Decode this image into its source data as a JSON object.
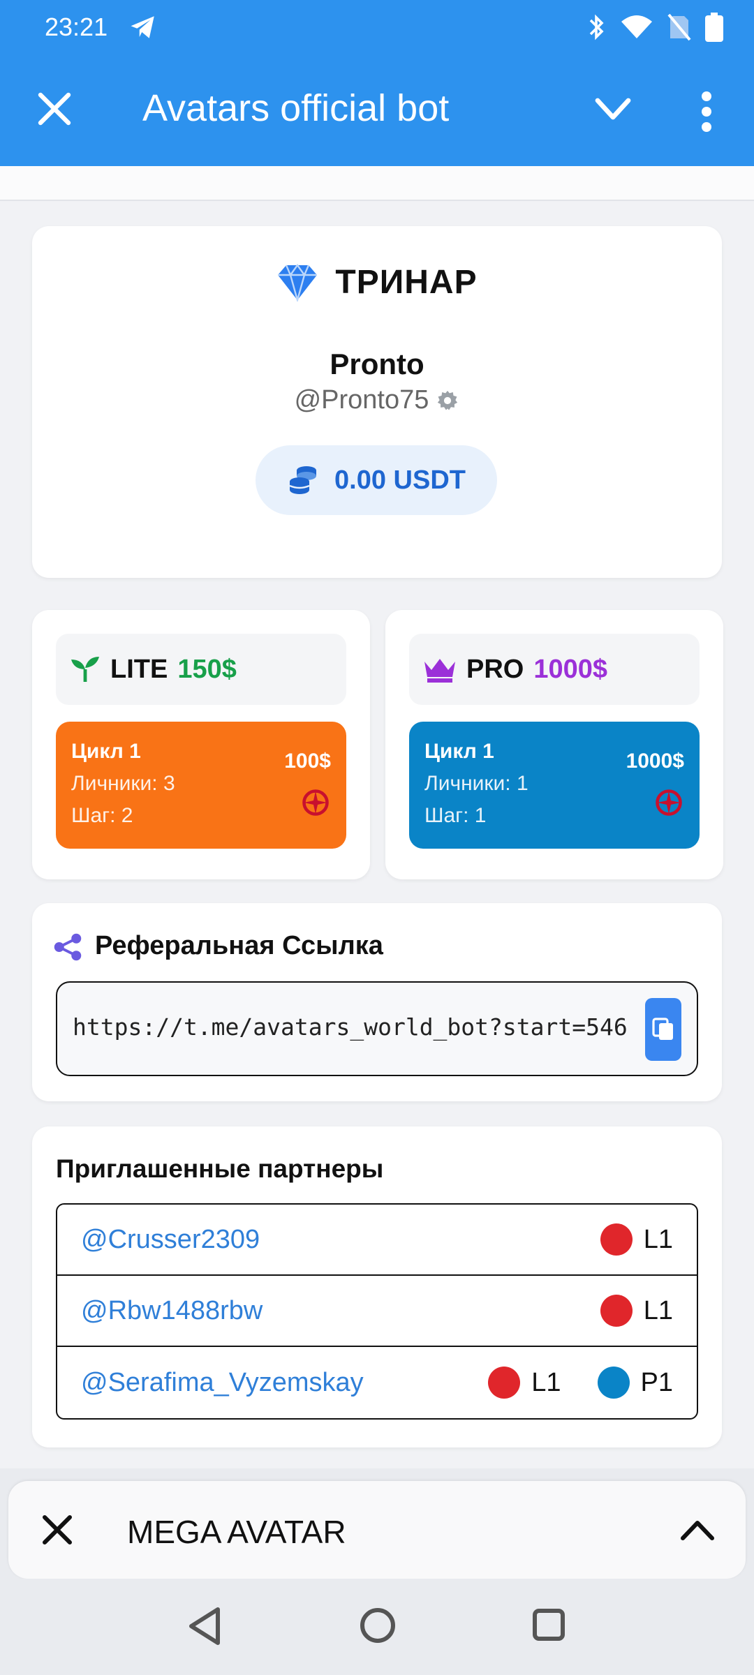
{
  "status_bar": {
    "time": "23:21"
  },
  "app_bar": {
    "title": "Avatars official bot"
  },
  "profile": {
    "brand": "ТРИНАР",
    "name": "Pronto",
    "handle": "@Pronto75",
    "balance": "0.00 USDT"
  },
  "plans": {
    "lite": {
      "name": "LITE",
      "price": "150$",
      "cycle": "Цикл 1",
      "personal": "Личники: 3",
      "step": "Шаг: 2",
      "amount": "100$"
    },
    "pro": {
      "name": "PRO",
      "price": "1000$",
      "cycle": "Цикл 1",
      "personal": "Личники: 1",
      "step": "Шаг: 1",
      "amount": "1000$"
    }
  },
  "referral": {
    "title": "Реферальная Ссылка",
    "link": "https://t.me/avatars_world_bot?start=546"
  },
  "partners": {
    "title": "Приглашенные партнеры",
    "rows": [
      {
        "name": "@Crusser2309",
        "badges": [
          {
            "label": "L1",
            "color": "#e0262b"
          }
        ]
      },
      {
        "name": "@Rbw1488rbw",
        "badges": [
          {
            "label": "L1",
            "color": "#e0262b"
          }
        ]
      },
      {
        "name": "@Serafima_Vyzemskay",
        "badges": [
          {
            "label": "L1",
            "color": "#e0262b"
          },
          {
            "label": "P1",
            "color": "#0a84c7"
          }
        ]
      }
    ]
  },
  "bottom_sheet": {
    "title": "MEGA AVATAR"
  },
  "colors": {
    "accent": "#2d92ee",
    "lite": "#f97316",
    "pro": "#0a84c7",
    "lite_price": "#18a04a",
    "pro_price": "#9b30d8"
  }
}
